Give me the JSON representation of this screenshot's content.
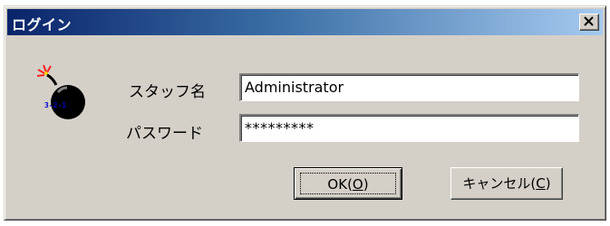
{
  "window": {
    "title": "ログイン",
    "close_icon": "close-icon"
  },
  "icon": {
    "name": "bomb-icon",
    "caption": "3-2-1"
  },
  "form": {
    "staff_label": "スタッフ名",
    "staff_value": "Administrator",
    "password_label": "パスワード",
    "password_value": "*********"
  },
  "buttons": {
    "ok_label": "OK",
    "ok_mnemonic": "O",
    "cancel_label": "キャンセル",
    "cancel_mnemonic": "C"
  },
  "colors": {
    "dialog_face": "#d4d0c8",
    "titlebar_start": "#0a246a",
    "titlebar_end": "#a6caf0",
    "bomb_caption": "#0000cc"
  }
}
